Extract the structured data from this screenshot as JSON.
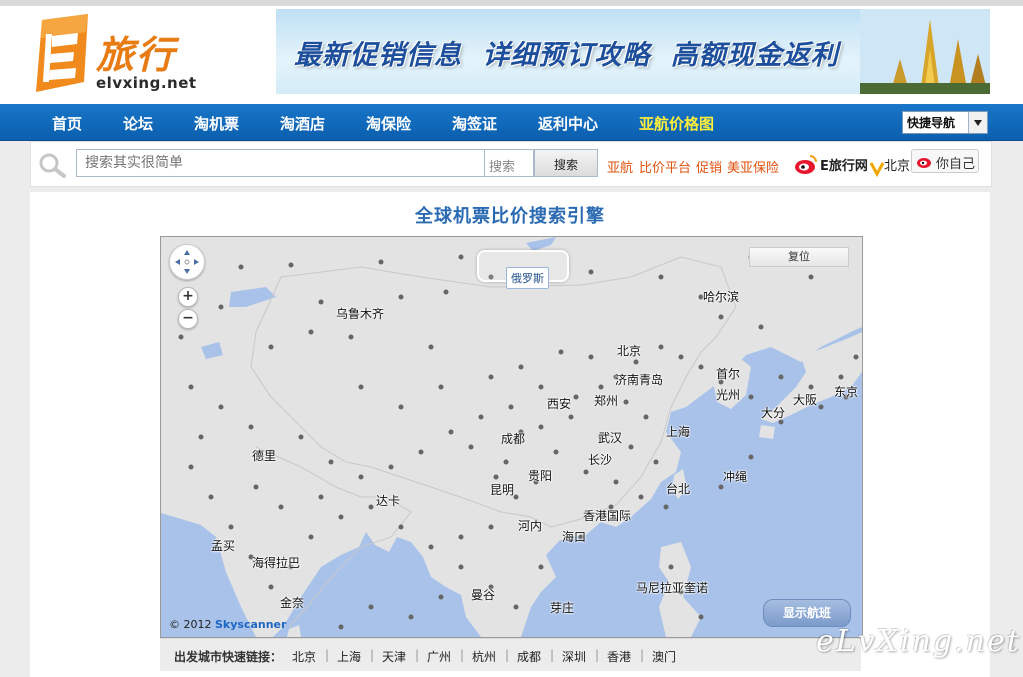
{
  "logo": {
    "cn": "旅行",
    "en": "elvxing.net"
  },
  "banner": {
    "text": "最新促销信息 详细预订攻略 高额现金返利"
  },
  "nav": {
    "items": [
      {
        "label": "首页"
      },
      {
        "label": "论坛"
      },
      {
        "label": "淘机票"
      },
      {
        "label": "淘酒店"
      },
      {
        "label": "淘保险"
      },
      {
        "label": "淘签证"
      },
      {
        "label": "返利中心"
      },
      {
        "label": "亚航价格图"
      }
    ],
    "quick_nav": "快捷导航"
  },
  "search": {
    "placeholder": "搜索其实很简单",
    "type": "搜索",
    "button": "搜索",
    "links": [
      "亚航",
      "比价平台",
      "促销",
      "美亚保险"
    ],
    "weibo_sina": "E旅行网",
    "weibo_city": "北京",
    "weibo_mine": "你自己"
  },
  "page": {
    "title": "全球机票比价搜索引擎"
  },
  "map": {
    "reset": "复位",
    "russia": "俄罗斯",
    "show_flights": "显示航班",
    "copyright_prefix": "© 2012",
    "copyright_brand": "Skyscanner",
    "cities": [
      "乌鲁木齐",
      "哈尔滨",
      "北京",
      "济南",
      "青岛",
      "首尔",
      "光州",
      "大阪",
      "大分",
      "东京",
      "西安",
      "郑州",
      "成都",
      "武汉",
      "上海",
      "长沙",
      "德里",
      "贵阳",
      "昆明",
      "台北",
      "冲绳",
      "香港国际",
      "达卡",
      "河内",
      "海口",
      "孟买",
      "海得拉巴",
      "金奈",
      "曼谷",
      "芽庄",
      "马尼拉亚奎诺"
    ]
  },
  "quicklinks": {
    "label": "出发城市快速链接：",
    "cities": [
      "北京",
      "上海",
      "天津",
      "广州",
      "杭州",
      "成都",
      "深圳",
      "香港",
      "澳门"
    ]
  },
  "watermark": "eLvXing.net",
  "colors": {
    "nav": "#0b5fae",
    "nav_highlight": "#ffef3a",
    "title": "#2a6ab2",
    "link": "#e0520e",
    "map_sea": "#a9c2ea",
    "map_land": "#e3e3e3"
  }
}
